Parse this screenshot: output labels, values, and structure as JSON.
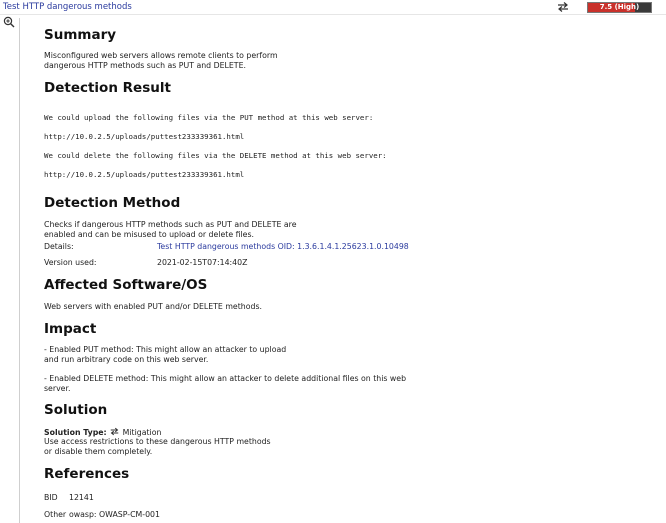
{
  "header": {
    "title": "Test HTTP dangerous methods",
    "severity": {
      "label": "7.5 (High)",
      "score": 7.5,
      "max": 10,
      "fill_color": "#c9312b",
      "bg_color": "#3a3a3a"
    }
  },
  "sections": {
    "summary": {
      "heading": "Summary",
      "text": "Misconfigured web servers allows remote clients to perform\ndangerous HTTP methods such as PUT and DELETE."
    },
    "detection_result": {
      "heading": "Detection Result",
      "lines": [
        "We could upload the following files via the PUT method at this web server:",
        "http://10.0.2.5/uploads/puttest233339361.html",
        "We could delete the following files via the DELETE method at this web server:",
        "http://10.0.2.5/uploads/puttest233339361.html"
      ]
    },
    "detection_method": {
      "heading": "Detection Method",
      "text": "Checks if dangerous HTTP methods such as PUT and DELETE are\nenabled and can be misused to upload or delete files.",
      "details_label": "Details:",
      "details_value": "Test HTTP dangerous methods OID: 1.3.6.1.4.1.25623.1.0.10498",
      "version_label": "Version used:",
      "version_value": "2021-02-15T07:14:40Z"
    },
    "affected": {
      "heading": "Affected Software/OS",
      "text": "Web servers with enabled PUT and/or DELETE methods."
    },
    "impact": {
      "heading": "Impact",
      "para1": "- Enabled PUT method: This might allow an attacker to upload\nand run arbitrary code on this web server.",
      "para2": "- Enabled DELETE method: This might allow an attacker to delete additional files on this web\nserver."
    },
    "solution": {
      "heading": "Solution",
      "type_label": "Solution Type:",
      "type_value": "Mitigation",
      "text": "Use access restrictions to these dangerous HTTP methods\nor disable them completely."
    },
    "references": {
      "heading": "References",
      "bid_label": "BID",
      "bid_value": "12141",
      "other_label": "Other",
      "other_value": "owasp: OWASP-CM-001"
    }
  }
}
